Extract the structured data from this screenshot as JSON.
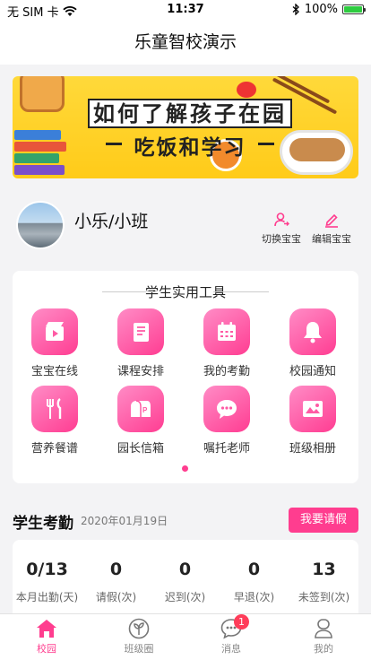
{
  "status_bar": {
    "carrier": "无 SIM 卡",
    "time": "11:37",
    "battery": "100%",
    "battery_level": 1.0
  },
  "nav": {
    "title": "乐童智校演示"
  },
  "banner": {
    "line1": "如何了解孩子在园",
    "line2": "吃饭和学习"
  },
  "profile": {
    "name": "小乐/小班",
    "switch_label": "切换宝宝",
    "edit_label": "编辑宝宝"
  },
  "tools": {
    "title": "学生实用工具",
    "items": [
      {
        "label": "宝宝在线",
        "icon": "video-icon"
      },
      {
        "label": "课程安排",
        "icon": "book-icon"
      },
      {
        "label": "我的考勤",
        "icon": "calendar-icon"
      },
      {
        "label": "校园通知",
        "icon": "bell-icon"
      },
      {
        "label": "营养餐谱",
        "icon": "cutlery-icon"
      },
      {
        "label": "园长信箱",
        "icon": "mailbox-icon"
      },
      {
        "label": "嘱托老师",
        "icon": "chat-icon"
      },
      {
        "label": "班级相册",
        "icon": "photo-icon"
      }
    ],
    "page_count": 1,
    "current_page": 1
  },
  "attendance": {
    "title": "学生考勤",
    "date": "2020年01月19日",
    "leave_button": "我要请假",
    "stats": [
      {
        "value": "0/13",
        "label": "本月出勤(天)"
      },
      {
        "value": "0",
        "label": "请假(次)"
      },
      {
        "value": "0",
        "label": "迟到(次)"
      },
      {
        "value": "0",
        "label": "早退(次)"
      },
      {
        "value": "13",
        "label": "未签到(次)"
      }
    ]
  },
  "tabbar": {
    "items": [
      {
        "label": "校园",
        "icon": "home-icon",
        "active": true
      },
      {
        "label": "班级圈",
        "icon": "sprout-icon",
        "active": false
      },
      {
        "label": "消息",
        "icon": "message-icon",
        "active": false,
        "badge": "1"
      },
      {
        "label": "我的",
        "icon": "profile-icon",
        "active": false
      }
    ]
  },
  "colors": {
    "accent": "#ff3d8f",
    "badge": "#ff3d5a",
    "banner_yellow": "#ffcb19"
  }
}
